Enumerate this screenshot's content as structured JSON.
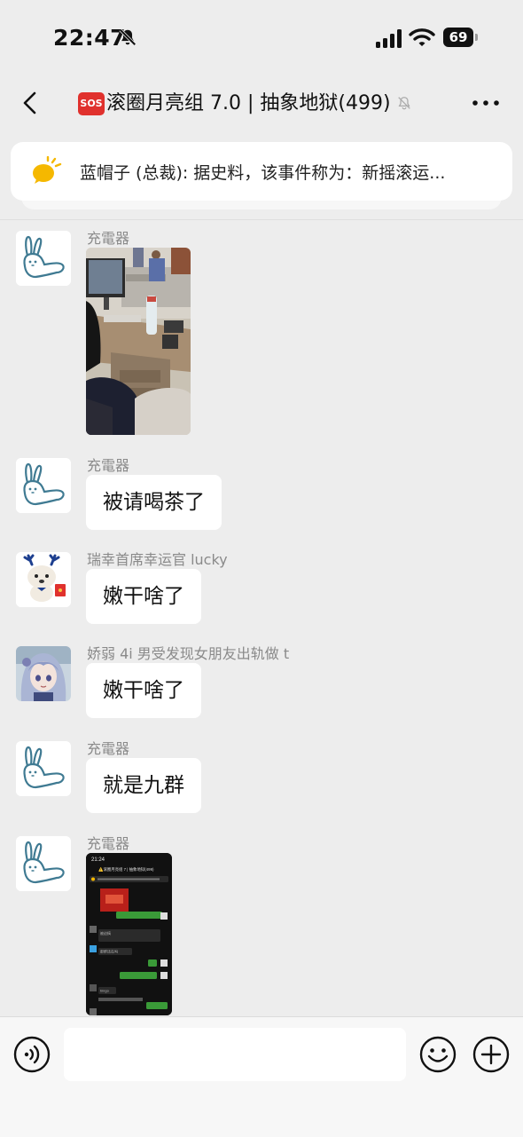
{
  "status_bar": {
    "time": "22:47",
    "battery": "69"
  },
  "header": {
    "sos": "SOS",
    "title": "滚圈月亮组 7.0 | 抽象地狱(499)"
  },
  "notice": {
    "text": "蓝帽子 (总裁): 据史料，该事件称为：新摇滚运..."
  },
  "messages": [
    {
      "sender": "充電器",
      "type": "image",
      "image": "office-photo"
    },
    {
      "sender": "充電器",
      "type": "text",
      "text": "被请喝茶了"
    },
    {
      "sender": "瑞幸首席幸运官 lucky",
      "type": "text",
      "text": "嫩干啥了"
    },
    {
      "sender": "娇弱 4i 男受发现女朋友出轨做 t",
      "type": "text",
      "text": "嫩干啥了"
    },
    {
      "sender": "充電器",
      "type": "text",
      "text": "就是九群"
    },
    {
      "sender": "充電器",
      "type": "image",
      "image": "chat-screenshot"
    }
  ],
  "screenshot_thumb": {
    "time": "21:24",
    "title": "⚠️滚圈月亮组 7 | 抽象地狱(499)",
    "bubble_1": "被迫搞",
    "bubble_2": "那群还在吗",
    "bubble_3": "bingo"
  },
  "input": {
    "placeholder": ""
  },
  "colors": {
    "background": "#ededed",
    "bubble": "#ffffff",
    "sender": "#8a8a8a",
    "sos": "#e0312d",
    "wechat_green": "#95ec69"
  }
}
